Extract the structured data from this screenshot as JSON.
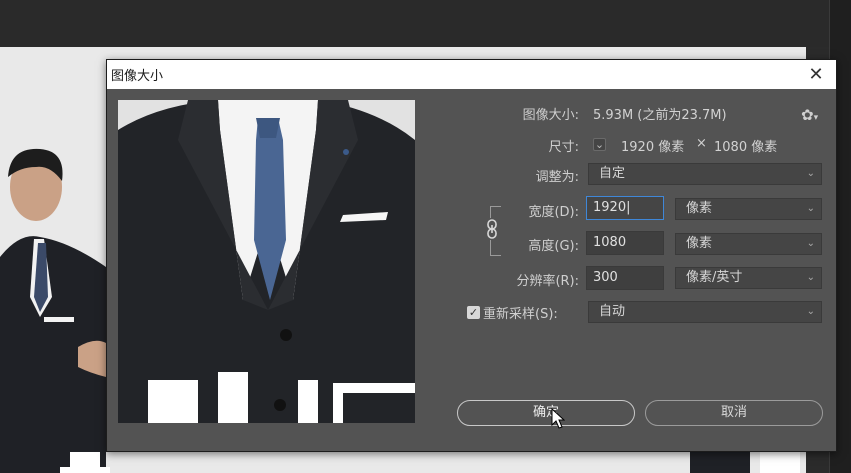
{
  "dialog": {
    "title": "图像大小",
    "close_glyph": "✕",
    "image_size_label": "图像大小:",
    "image_size_value": "5.93M (之前为23.7M)",
    "dimensions_label": "尺寸:",
    "dimensions_width": "1920 像素",
    "dimensions_times": "×",
    "dimensions_height": "1080 像素",
    "fit_to_label": "调整为:",
    "fit_to_value": "自定",
    "width_label": "宽度(D):",
    "width_value": "1920",
    "width_unit": "像素",
    "height_label": "高度(G):",
    "height_value": "1080",
    "height_unit": "像素",
    "resolution_label": "分辨率(R):",
    "resolution_value": "300",
    "resolution_unit": "像素/英寸",
    "resample_label": "重新采样(S):",
    "resample_value": "自动",
    "resample_checked": true,
    "ok_label": "确定",
    "cancel_label": "取消",
    "gear_icon": "gear-icon",
    "caret_glyph": "⌄"
  },
  "colors": {
    "dialog_bg": "#535353",
    "focus": "#3f87d8"
  }
}
